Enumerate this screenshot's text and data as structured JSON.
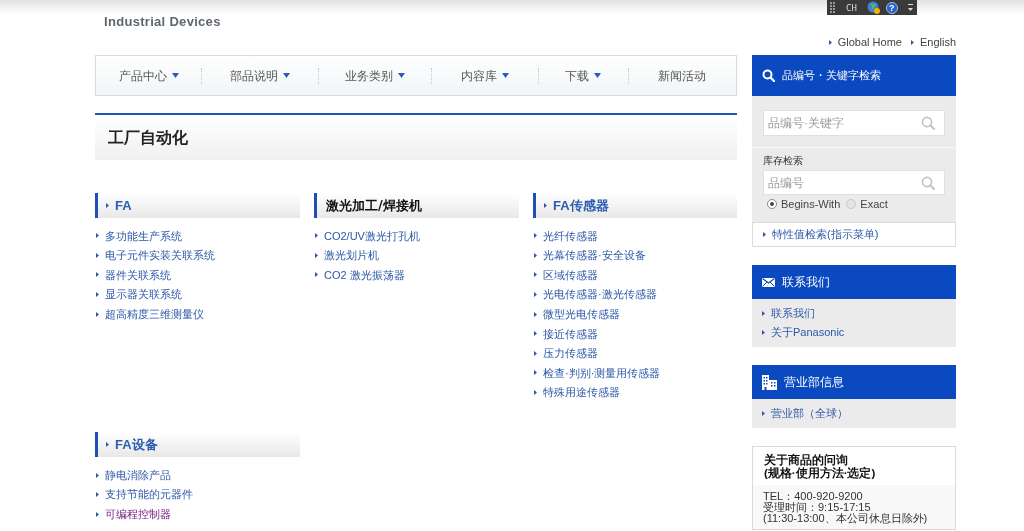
{
  "language_bar": {
    "label": "CH",
    "help": "?"
  },
  "header": {
    "brand": "Industrial Devices",
    "top_links": [
      "Global Home",
      "English"
    ]
  },
  "nav": [
    {
      "label": "产品中心",
      "dropdown": true
    },
    {
      "label": "部品说明",
      "dropdown": true
    },
    {
      "label": "业务类别",
      "dropdown": true
    },
    {
      "label": "内容库",
      "dropdown": true
    },
    {
      "label": "下载",
      "dropdown": true
    },
    {
      "label": "新闻活动",
      "dropdown": false
    }
  ],
  "page_title": "工厂自动化",
  "categories": [
    {
      "title": "FA",
      "kind": "bullet",
      "links": [
        {
          "text": "多功能生产系统",
          "visited": false
        },
        {
          "text": "电子元件实装关联系统",
          "visited": false
        },
        {
          "text": "器件关联系统",
          "visited": false
        },
        {
          "text": "显示器关联系统",
          "visited": false
        },
        {
          "text": "超高精度三维测量仪",
          "visited": false
        }
      ]
    },
    {
      "title": "激光加工/焊接机",
      "kind": "plain",
      "links": [
        {
          "text": "CO2/UV激光打孔机",
          "visited": false
        },
        {
          "text": "激光划片机",
          "visited": false
        },
        {
          "text": "CO2 激光振荡器",
          "visited": false
        }
      ]
    },
    {
      "title": "FA传感器",
      "kind": "bullet",
      "links": [
        {
          "text": "光纤传感器",
          "visited": false
        },
        {
          "text": "光幕传感器·安全设备",
          "visited": false
        },
        {
          "text": "区域传感器",
          "visited": false
        },
        {
          "text": "光电传感器·激光传感器",
          "visited": false
        },
        {
          "text": "微型光电传感器",
          "visited": false
        },
        {
          "text": "接近传感器",
          "visited": false
        },
        {
          "text": "压力传感器",
          "visited": false
        },
        {
          "text": "检查·判别·测量用传感器",
          "visited": false
        },
        {
          "text": "特殊用途传感器",
          "visited": false
        }
      ]
    },
    {
      "title": "FA设备",
      "kind": "bullet",
      "links": [
        {
          "text": "静电消除产品",
          "visited": false
        },
        {
          "text": "支持节能的元器件",
          "visited": false
        },
        {
          "text": "可编程控制器",
          "visited": true
        }
      ]
    }
  ],
  "sidebar": {
    "search": {
      "title": "品编号・关键字检索",
      "keyword_field": {
        "placeholder": "品编号·关键字"
      },
      "stock_label": "库存检索",
      "stock_field": {
        "placeholder": "品编号"
      },
      "match_options": [
        {
          "label": "Begins-With",
          "selected": true
        },
        {
          "label": "Exact",
          "selected": false
        }
      ],
      "spec_link": "特性值检索(指示菜单)"
    },
    "contact": {
      "title": "联系我们",
      "links": [
        "联系我们",
        "关于Panasonic"
      ]
    },
    "offices": {
      "title": "营业部信息",
      "links": [
        "营业部（全球）"
      ]
    },
    "inquiry": {
      "title_lines": [
        "关于商品的问询",
        "(规格·使用方法·选定)"
      ],
      "details": [
        "TEL：400-920-9200",
        "受理时间：9:15-17:15",
        "(11:30-13:00、本公司休息日除外)"
      ]
    }
  }
}
